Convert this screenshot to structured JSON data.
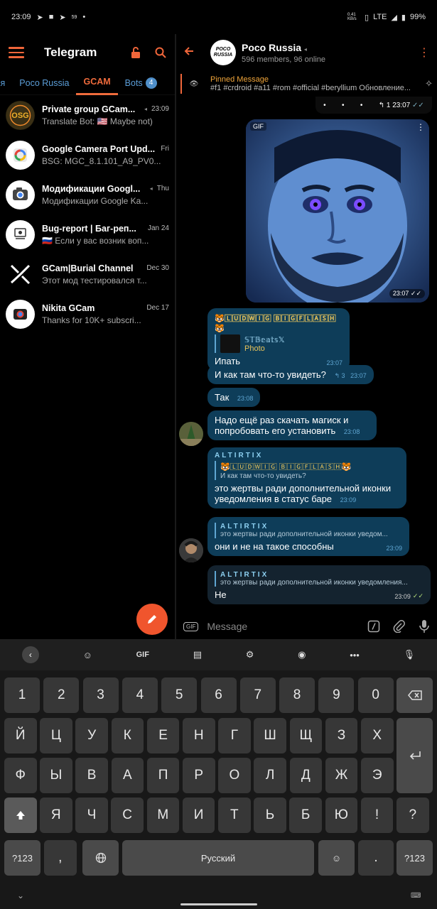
{
  "status_bar": {
    "time": "23:09",
    "notif_count": "59",
    "net_speed": "0.41 KB/s",
    "network": "LTE",
    "battery": "99%"
  },
  "left_pane": {
    "title": "Telegram",
    "tabs": [
      {
        "label": "ья"
      },
      {
        "label": "Poco Russia"
      },
      {
        "label": "GCAM"
      },
      {
        "label": "Bots",
        "badge": "4"
      }
    ],
    "chats": [
      {
        "name": "Private group GCam...",
        "time": "23:09",
        "message": "Translate Bot: 🇺🇸 Maybe not)",
        "muted": true
      },
      {
        "name": "Google Camera Port Upd...",
        "time": "Fri",
        "message": "BSG: MGC_8.1.101_A9_PV0..."
      },
      {
        "name": "Модификации Googl...",
        "time": "Thu",
        "message": "Модификации Google Ka...",
        "muted": true
      },
      {
        "name": "Bug-report | Баг-реп...",
        "time": "Jan 24",
        "message": "🇷🇺 Если у вас возник воп..."
      },
      {
        "name": "GCam|Burial Channel",
        "time": "Dec 30",
        "message": "Этот мод тестировался т..."
      },
      {
        "name": "Nikita GCam",
        "time": "Dec 17",
        "message": "Thanks for 10K+ subscri..."
      }
    ]
  },
  "chat": {
    "group_logo_top": "POCO",
    "group_logo_bottom": "RUSSIA",
    "group_name": "Poco Russia",
    "group_sub": "596 members, 96 online",
    "pinned_title": "Pinned Message",
    "pinned_text": "#f1 #crdroid #a11 #rom #official #beryllium Обновление...",
    "toolbar_reply_count": "1",
    "toolbar_time": "23:07",
    "gif_label": "GIF",
    "gif_time": "23:07",
    "messages": [
      {
        "author": "🐯🄻🅄🄳🅆🄸🄶 🄱🄸🄶🄵🄻🄰🅂🄷🐯",
        "quote_author": "𝕊𝕋𝔹𝕖𝕒𝕥𝕤𝕏",
        "quote_text": "Photo",
        "text": "Ипать",
        "time": "23:07"
      },
      {
        "text": "И как там что-то увидеть?",
        "replies": "3",
        "time": "23:07"
      },
      {
        "text": "Так",
        "time": "23:08"
      },
      {
        "text": "Надо ещё раз скачать магиск и попробовать его установить",
        "time": "23:08"
      },
      {
        "author": "ALTIRTIX",
        "quote_author": "🐯🄻🅄🄳🅆🄸🄶 🄱🄸🄶🄵🄻🄰🅂🄷🐯",
        "quote_text": "И как там что-то увидеть?",
        "text": "это жертвы ради дополнительной иконки уведомления в статус баре",
        "time": "23:09"
      },
      {
        "quote_author": "ALTIRTIX",
        "quote_text": "это жертвы ради дополнительной иконки уведом...",
        "text": "они и не на такое способны",
        "time": "23:09"
      },
      {
        "quote_author": "ALTIRTIX",
        "quote_text": "это жертвы ради дополнительной иконки уведомления...",
        "text": "Не",
        "time": "23:09"
      }
    ],
    "input_placeholder": "Message",
    "gif_button": "GIF"
  },
  "keyboard": {
    "toolbar_gif": "GIF",
    "row1": [
      "1",
      "2",
      "3",
      "4",
      "5",
      "6",
      "7",
      "8",
      "9",
      "0"
    ],
    "row2": [
      "Й",
      "Ц",
      "У",
      "К",
      "Е",
      "Н",
      "Г",
      "Ш",
      "Щ",
      "З",
      "Х"
    ],
    "row3": [
      "Ф",
      "Ы",
      "В",
      "А",
      "П",
      "Р",
      "О",
      "Л",
      "Д",
      "Ж",
      "Э"
    ],
    "row4": [
      "Я",
      "Ч",
      "С",
      "М",
      "И",
      "Т",
      "Ь",
      "Б",
      "Ю",
      "!",
      "?"
    ],
    "symbols_left": "?123",
    "comma": ",",
    "space": "Русский",
    "period": ".",
    "symbols_right": "?123"
  },
  "colors": {
    "accent": "#f0663a",
    "bubble": "#0e3d59",
    "link": "#5b9ed8"
  }
}
